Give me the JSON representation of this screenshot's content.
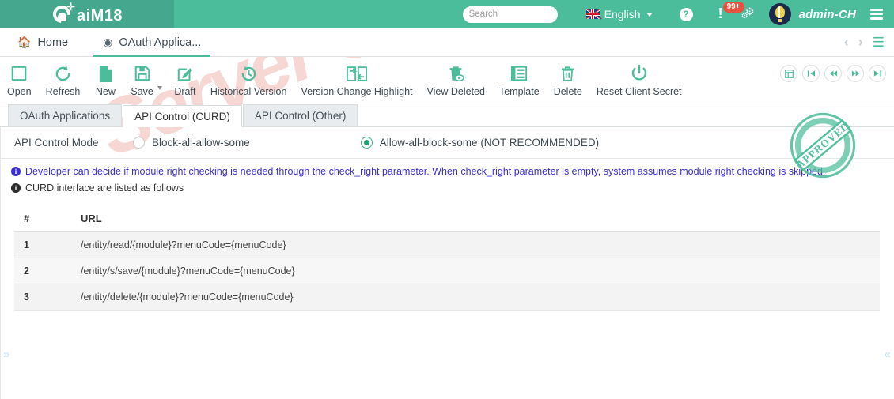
{
  "header": {
    "logo_text": "aiM18",
    "search": {
      "placeholder": "Search",
      "value": ""
    },
    "search_icon": "search-icon",
    "language": "English",
    "help_icon": "question-mark-icon",
    "notification_badge": "99+",
    "username": "admin-CH",
    "menu_icon": "list-menu-icon"
  },
  "browser_tabs": [
    {
      "label": "Home",
      "icon": "home-icon",
      "active": false
    },
    {
      "label": "OAuth Applica...",
      "icon": "cube-icon",
      "active": true
    }
  ],
  "tab_nav": {
    "prev_icon": "chevron-left-icon",
    "next_icon": "chevron-right-icon",
    "layers_icon": "layers-icon"
  },
  "toolbar": {
    "items": [
      {
        "label": "Open",
        "icon": "square-outline-icon"
      },
      {
        "label": "Refresh",
        "icon": "refresh-circular-arrow-icon"
      },
      {
        "label": "New",
        "icon": "new-document-icon"
      },
      {
        "label": "Save",
        "icon": "floppy-disk-icon"
      },
      {
        "label": "Draft",
        "icon": "pencil-edit-icon"
      },
      {
        "label": "Historical Version",
        "icon": "clock-history-icon"
      },
      {
        "label": "Version Change Highlight",
        "icon": "compare-arrows-icon"
      },
      {
        "label": "View Deleted",
        "icon": "trash-eye-icon"
      },
      {
        "label": "Template",
        "icon": "template-grid-icon"
      },
      {
        "label": "Delete",
        "icon": "trash-bin-icon"
      },
      {
        "label": "Reset Client Secret",
        "icon": "power-icon"
      }
    ],
    "nav_buttons": [
      {
        "icon": "panel-layout-icon"
      },
      {
        "icon": "first-record-icon"
      },
      {
        "icon": "previous-record-icon"
      },
      {
        "icon": "next-record-icon"
      },
      {
        "icon": "last-record-icon"
      }
    ]
  },
  "inner_tabs": [
    {
      "label": "OAuth Applications",
      "active": false
    },
    {
      "label": "API Control (CURD)",
      "active": true
    },
    {
      "label": "API Control (Other)",
      "active": false
    }
  ],
  "form": {
    "api_control_mode_label": "API Control Mode",
    "options": [
      {
        "label": "Block-all-allow-some",
        "selected": false
      },
      {
        "label": "Allow-all-block-some (NOT RECOMMENDED)",
        "selected": true
      }
    ]
  },
  "info": {
    "line1": "Developer can decide if module right checking is needed through the check_right parameter. When check_right parameter is empty, system assumes module right checking is skipped.",
    "line2": "CURD interface are listed as follows",
    "icon": "info-circle-icon"
  },
  "table": {
    "columns": [
      "#",
      "URL"
    ],
    "rows": [
      {
        "index": "1",
        "url": "/entity/read/{module}?menuCode={menuCode}"
      },
      {
        "index": "2",
        "url": "/entity/s/save/{module}?menuCode={menuCode}"
      },
      {
        "index": "3",
        "url": "/entity/delete/{module}?menuCode={menuCode}"
      }
    ]
  },
  "stamp": {
    "text": "APPROVED",
    "color": "#4cbd9b"
  },
  "watermark": {
    "text": "Server Unregistered",
    "color": "#f6d7d4"
  },
  "bottom": {
    "expand_left_icon": "double-chevron-right-icon",
    "expand_right_icon": "double-chevron-left-icon"
  },
  "colors": {
    "brand": "#4cbd9b",
    "brand_dark": "#45a88e",
    "accent_red": "#e8513d",
    "info_blue": "#3b2fd4"
  }
}
